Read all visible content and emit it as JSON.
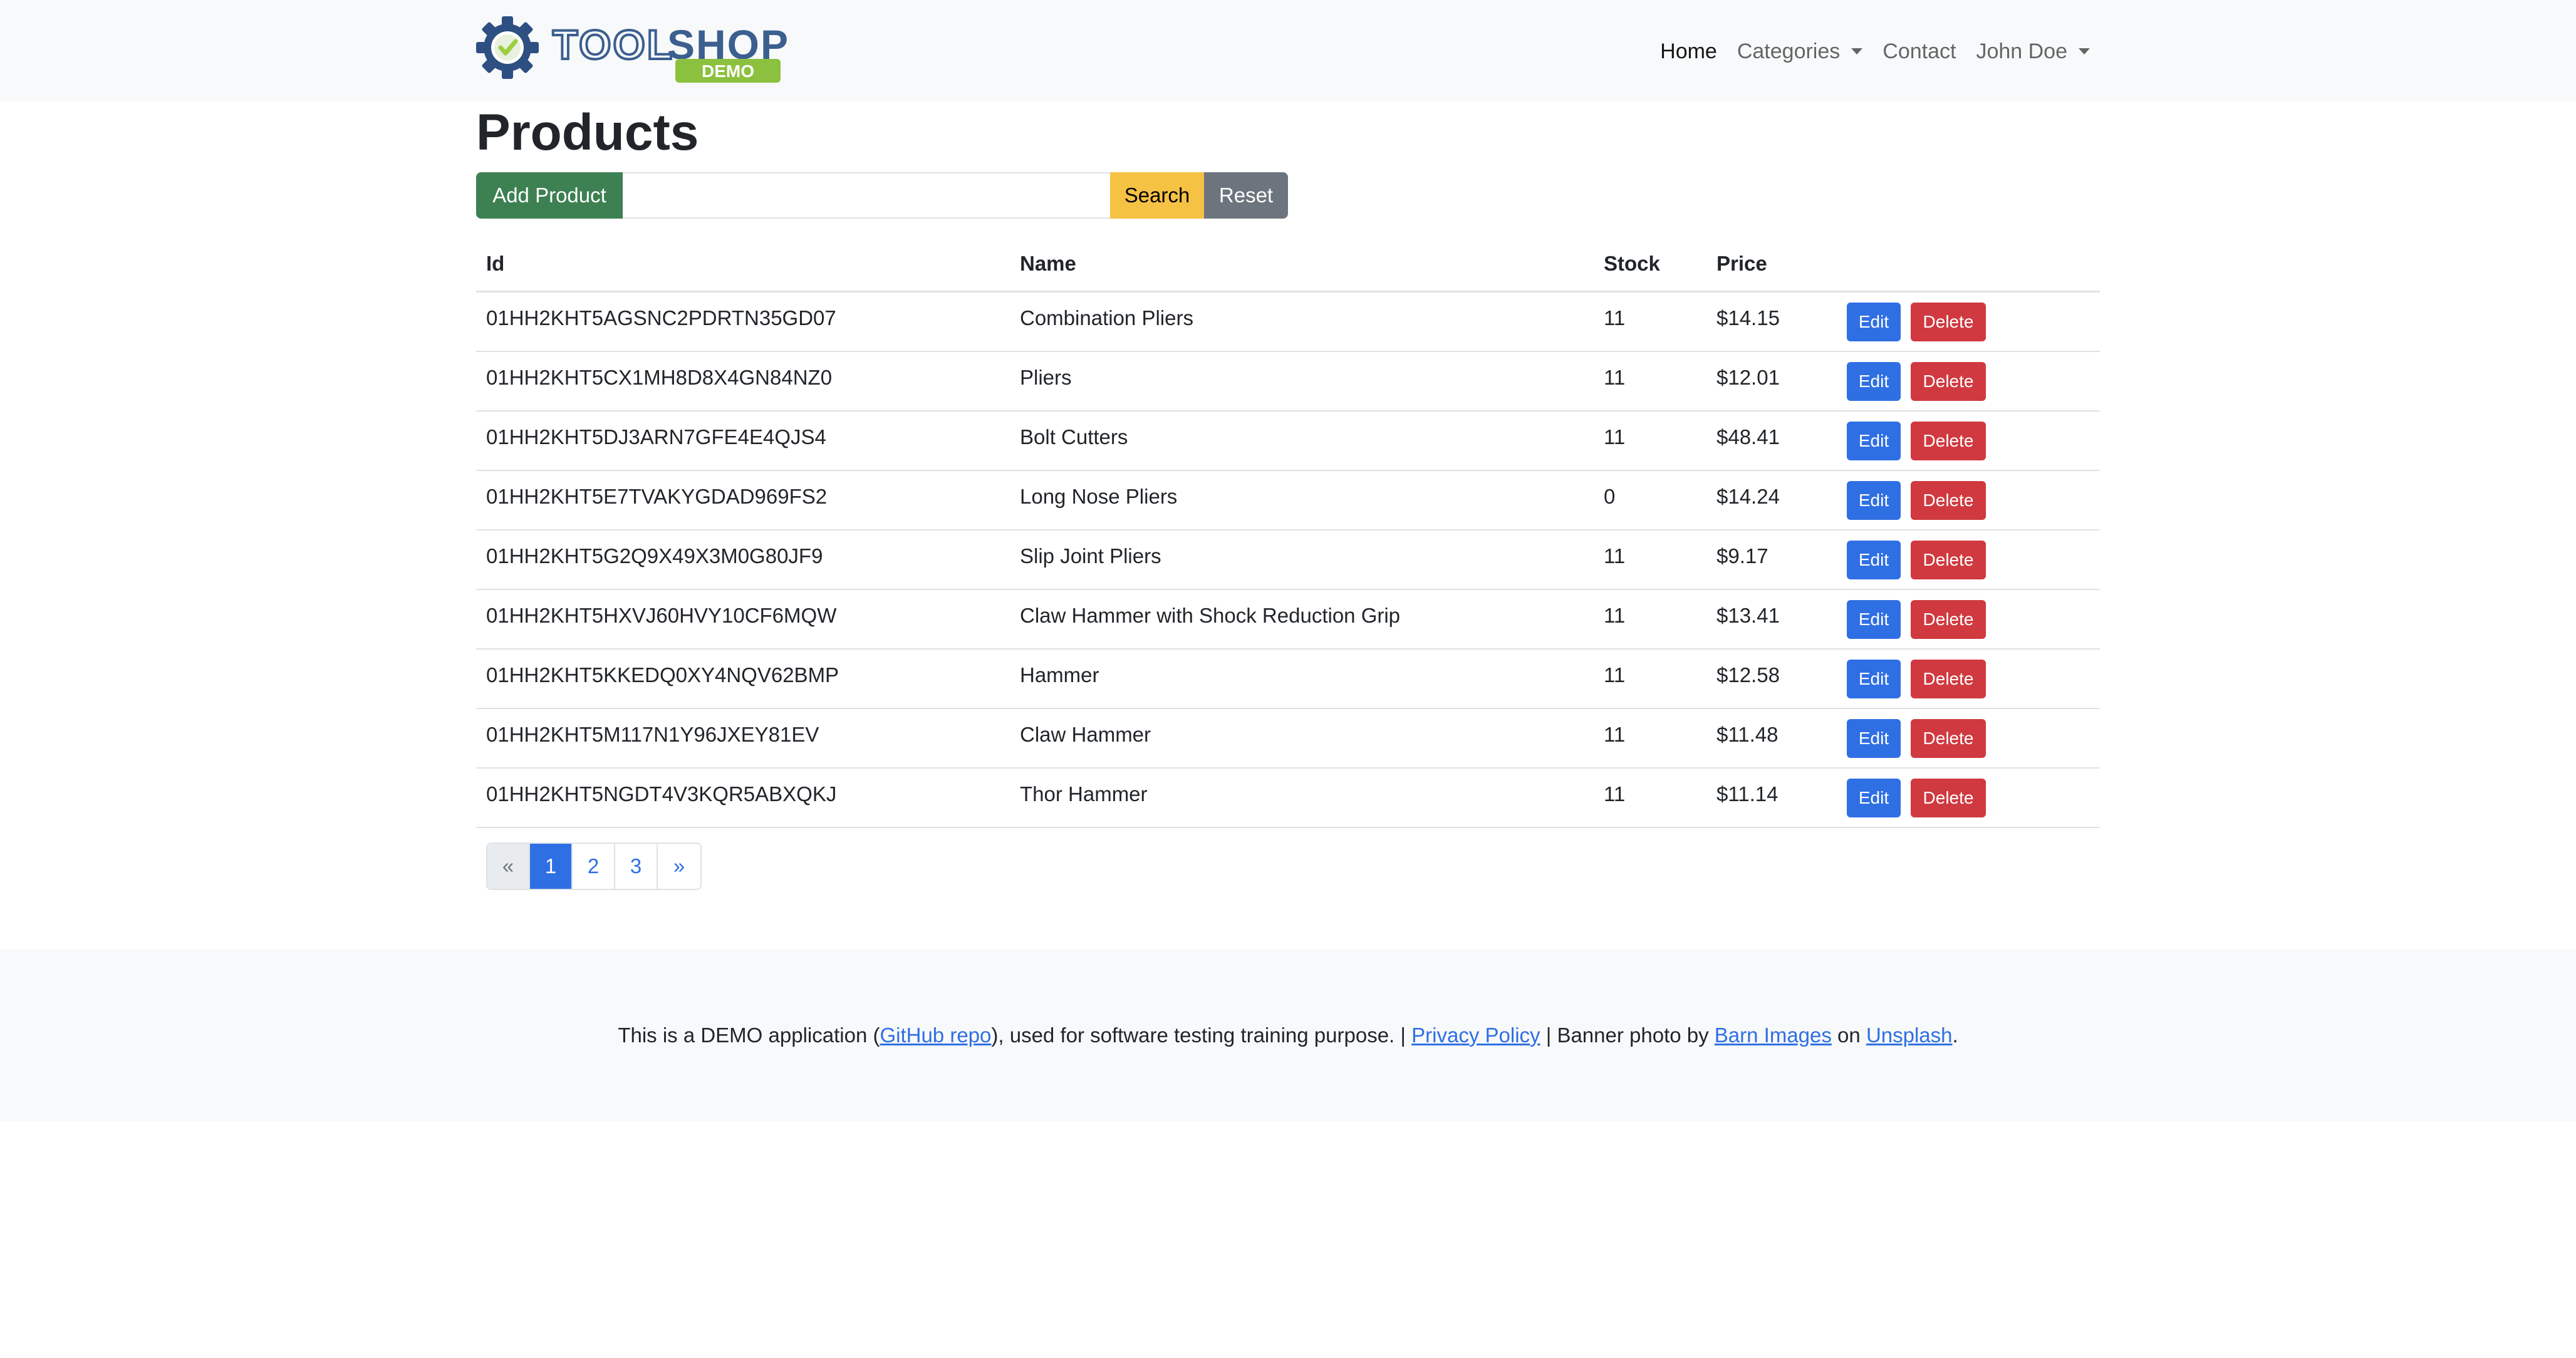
{
  "brand": {
    "name_part1": "TOOL",
    "name_part2": "SHOP",
    "badge": "DEMO",
    "colors": {
      "gear": "#2d4f82",
      "text": "#3b5f8f",
      "badge": "#8cc13f",
      "check": "#9bcf3e"
    }
  },
  "nav": {
    "home": "Home",
    "categories": "Categories",
    "contact": "Contact",
    "user": "John Doe"
  },
  "page": {
    "title": "Products"
  },
  "search": {
    "add_label": "Add Product",
    "input_value": "",
    "search_label": "Search",
    "reset_label": "Reset"
  },
  "table": {
    "headers": {
      "id": "Id",
      "name": "Name",
      "stock": "Stock",
      "price": "Price",
      "actions": ""
    },
    "edit_label": "Edit",
    "delete_label": "Delete",
    "rows": [
      {
        "id": "01HH2KHT5AGSNC2PDRTN35GD07",
        "name": "Combination Pliers",
        "stock": "11",
        "price": "$14.15"
      },
      {
        "id": "01HH2KHT5CX1MH8D8X4GN84NZ0",
        "name": "Pliers",
        "stock": "11",
        "price": "$12.01"
      },
      {
        "id": "01HH2KHT5DJ3ARN7GFE4E4QJS4",
        "name": "Bolt Cutters",
        "stock": "11",
        "price": "$48.41"
      },
      {
        "id": "01HH2KHT5E7TVAKYGDAD969FS2",
        "name": "Long Nose Pliers",
        "stock": "0",
        "price": "$14.24"
      },
      {
        "id": "01HH2KHT5G2Q9X49X3M0G80JF9",
        "name": "Slip Joint Pliers",
        "stock": "11",
        "price": "$9.17"
      },
      {
        "id": "01HH2KHT5HXVJ60HVY10CF6MQW",
        "name": "Claw Hammer with Shock Reduction Grip",
        "stock": "11",
        "price": "$13.41"
      },
      {
        "id": "01HH2KHT5KKEDQ0XY4NQV62BMP",
        "name": "Hammer",
        "stock": "11",
        "price": "$12.58"
      },
      {
        "id": "01HH2KHT5M117N1Y96JXEY81EV",
        "name": "Claw Hammer",
        "stock": "11",
        "price": "$11.48"
      },
      {
        "id": "01HH2KHT5NGDT4V3KQR5ABXQKJ",
        "name": "Thor Hammer",
        "stock": "11",
        "price": "$11.14"
      }
    ]
  },
  "pagination": {
    "prev": "«",
    "pages": [
      "1",
      "2",
      "3"
    ],
    "current": "1",
    "next": "»"
  },
  "footer": {
    "text1": "This is a DEMO application (",
    "github_link": "GitHub repo",
    "text2": "), used for software testing training purpose. | ",
    "privacy_link": "Privacy Policy",
    "text3": " | Banner photo by ",
    "barn_link": "Barn Images",
    "text4": " on ",
    "unsplash_link": "Unsplash",
    "text5": "."
  }
}
